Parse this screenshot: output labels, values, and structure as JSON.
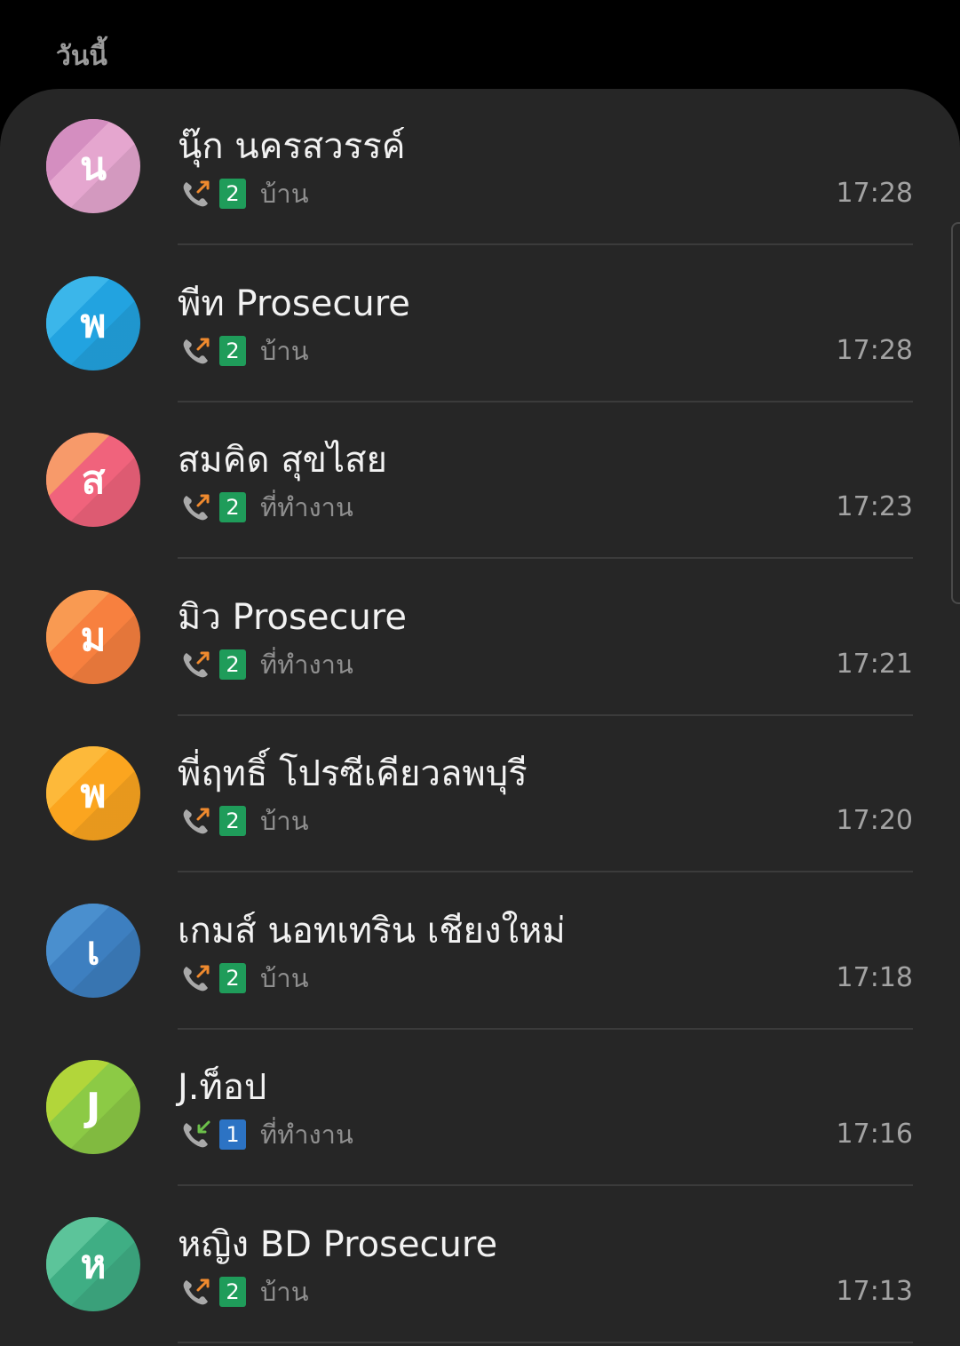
{
  "section": {
    "title": "วันนี้"
  },
  "colors": {
    "outgoing_arrow": "#f08a2e",
    "incoming_arrow": "#6cc04a",
    "sim_green": "#1f9c5a",
    "sim_blue": "#2c73c4"
  },
  "calls": [
    {
      "initial": "น",
      "name": "นุ๊ก นครสวรรค์",
      "direction": "outgoing",
      "direction_icon": "outgoing-call-icon",
      "sim": "2",
      "sim_color": "#1f9c5a",
      "label": "บ้าน",
      "time": "17:28",
      "avatar_color": "#e5a6cf",
      "avatar_accent": "#d48ec0"
    },
    {
      "initial": "พ",
      "name": "พีท Prosecure",
      "direction": "outgoing",
      "direction_icon": "outgoing-call-icon",
      "sim": "2",
      "sim_color": "#1f9c5a",
      "label": "บ้าน",
      "time": "17:28",
      "avatar_color": "#22a3e0",
      "avatar_accent": "#3bb6ea"
    },
    {
      "initial": "ส",
      "name": "สมคิด สุขไสย",
      "direction": "outgoing",
      "direction_icon": "outgoing-call-icon",
      "sim": "2",
      "sim_color": "#1f9c5a",
      "label": "ที่ทำงาน",
      "time": "17:23",
      "avatar_color": "#f0637c",
      "avatar_accent": "#f79a6a"
    },
    {
      "initial": "ม",
      "name": "มิว Prosecure",
      "direction": "outgoing",
      "direction_icon": "outgoing-call-icon",
      "sim": "2",
      "sim_color": "#1f9c5a",
      "label": "ที่ทำงาน",
      "time": "17:21",
      "avatar_color": "#f7803f",
      "avatar_accent": "#f99a52"
    },
    {
      "initial": "พ",
      "name": "พี่ฤทธิ์ โปรซีเคียวลพบุรี",
      "direction": "outgoing",
      "direction_icon": "outgoing-call-icon",
      "sim": "2",
      "sim_color": "#1f9c5a",
      "label": "บ้าน",
      "time": "17:20",
      "avatar_color": "#fba51f",
      "avatar_accent": "#fdb93a"
    },
    {
      "initial": "เ",
      "name": "เกมส์ นอทเทริน เชียงใหม่",
      "direction": "outgoing",
      "direction_icon": "outgoing-call-icon",
      "sim": "2",
      "sim_color": "#1f9c5a",
      "label": "บ้าน",
      "time": "17:18",
      "avatar_color": "#3d7fc0",
      "avatar_accent": "#4a8fce"
    },
    {
      "initial": "J",
      "name": "J.ท็อป",
      "direction": "incoming",
      "direction_icon": "incoming-call-icon",
      "sim": "1",
      "sim_color": "#2c73c4",
      "label": "ที่ทำงาน",
      "time": "17:16",
      "avatar_color": "#8cca45",
      "avatar_accent": "#b2d63a"
    },
    {
      "initial": "ห",
      "name": "หญิง BD Prosecure",
      "direction": "outgoing",
      "direction_icon": "outgoing-call-icon",
      "sim": "2",
      "sim_color": "#1f9c5a",
      "label": "บ้าน",
      "time": "17:13",
      "avatar_color": "#3fae84",
      "avatar_accent": "#5cc49a"
    }
  ]
}
